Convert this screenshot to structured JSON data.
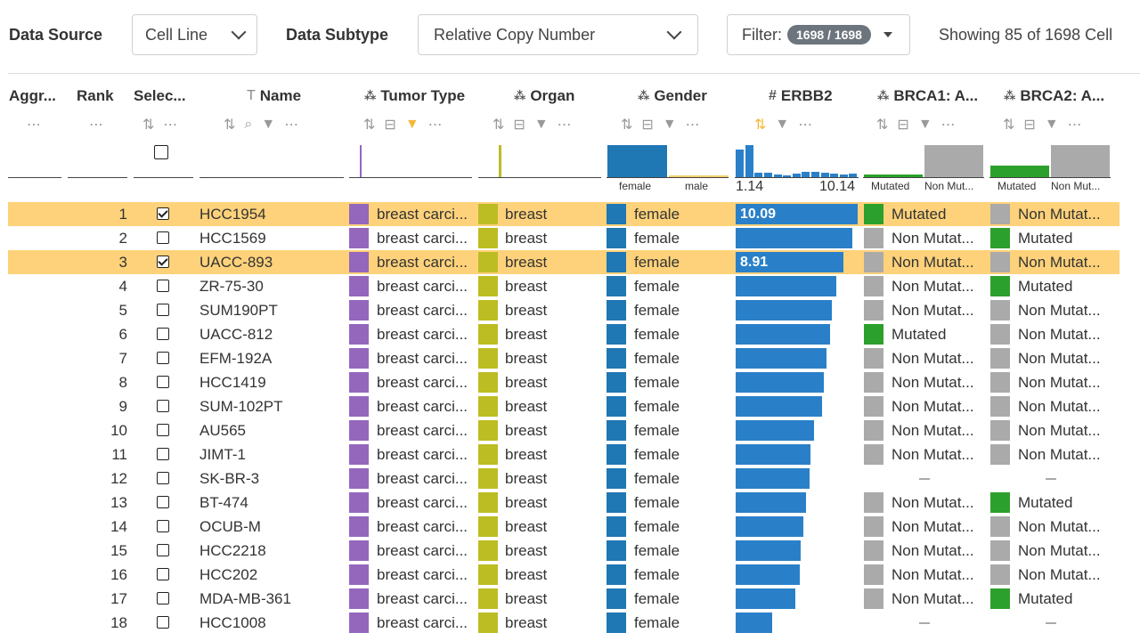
{
  "toolbar": {
    "data_source_label": "Data Source",
    "data_source_value": "Cell Line",
    "data_subtype_label": "Data Subtype",
    "data_subtype_value": "Relative Copy Number",
    "filter_label": "Filter:",
    "filter_count": "1698 / 1698",
    "showing_text": "Showing 85 of 1698 Cell"
  },
  "columns": {
    "aggr": "Aggr...",
    "rank": "Rank",
    "select": "Selec...",
    "name": "Name",
    "tumor_type": "Tumor Type",
    "organ": "Organ",
    "gender": "Gender",
    "erbb2": "ERBB2",
    "brca1": "BRCA1: A...",
    "brca2": "BRCA2: A..."
  },
  "summary": {
    "gender_female": "female",
    "gender_male": "male",
    "erbb2_min": "1.14",
    "erbb2_max": "10.14",
    "brca1_mutated": "Mutated",
    "brca1_non": "Non Mut...",
    "brca2_mutated": "Mutated",
    "brca2_non": "Non Mut...",
    "erbb2_hist": [
      0.85,
      1.0,
      0.15,
      0.15,
      0.08,
      0.05,
      0.1,
      0.18,
      0.18,
      0.14,
      0.12,
      0.08,
      0.12
    ],
    "brca1_mutated_frac": 0.5,
    "brca2_mutated_frac": 0.5
  },
  "colors": {
    "highlight": "#fed27a",
    "tumor": "#9467bd",
    "organ": "#bcbd22",
    "gender": "#1f77b4",
    "bar": "#2a80c8",
    "mutated": "#2ca02c",
    "non_mutated": "#aaaaaa"
  },
  "rows": [
    {
      "rank": "1",
      "selected": true,
      "name": "HCC1954",
      "tumor": "breast carci...",
      "organ": "breast",
      "gender": "female",
      "erbb2": 10.09,
      "erbb2_label": "10.09",
      "brca1": "Mutated",
      "brca2": "Non Mutat..."
    },
    {
      "rank": "2",
      "selected": false,
      "name": "HCC1569",
      "tumor": "breast carci...",
      "organ": "breast",
      "gender": "female",
      "erbb2": 9.6,
      "erbb2_label": "",
      "brca1": "Non Mutat...",
      "brca2": "Mutated"
    },
    {
      "rank": "3",
      "selected": true,
      "name": "UACC-893",
      "tumor": "breast carci...",
      "organ": "breast",
      "gender": "female",
      "erbb2": 8.91,
      "erbb2_label": "8.91",
      "brca1": "Non Mutat...",
      "brca2": "Non Mutat..."
    },
    {
      "rank": "4",
      "selected": false,
      "name": "ZR-75-30",
      "tumor": "breast carci...",
      "organ": "breast",
      "gender": "female",
      "erbb2": 8.3,
      "erbb2_label": "",
      "brca1": "Non Mutat...",
      "brca2": "Mutated"
    },
    {
      "rank": "5",
      "selected": false,
      "name": "SUM190PT",
      "tumor": "breast carci...",
      "organ": "breast",
      "gender": "female",
      "erbb2": 7.9,
      "erbb2_label": "",
      "brca1": "Non Mutat...",
      "brca2": "Non Mutat..."
    },
    {
      "rank": "6",
      "selected": false,
      "name": "UACC-812",
      "tumor": "breast carci...",
      "organ": "breast",
      "gender": "female",
      "erbb2": 7.8,
      "erbb2_label": "",
      "brca1": "Mutated",
      "brca2": "Non Mutat..."
    },
    {
      "rank": "7",
      "selected": false,
      "name": "EFM-192A",
      "tumor": "breast carci...",
      "organ": "breast",
      "gender": "female",
      "erbb2": 7.5,
      "erbb2_label": "",
      "brca1": "Non Mutat...",
      "brca2": "Non Mutat..."
    },
    {
      "rank": "8",
      "selected": false,
      "name": "HCC1419",
      "tumor": "breast carci...",
      "organ": "breast",
      "gender": "female",
      "erbb2": 7.3,
      "erbb2_label": "",
      "brca1": "Non Mutat...",
      "brca2": "Non Mutat..."
    },
    {
      "rank": "9",
      "selected": false,
      "name": "SUM-102PT",
      "tumor": "breast carci...",
      "organ": "breast",
      "gender": "female",
      "erbb2": 7.1,
      "erbb2_label": "",
      "brca1": "Non Mutat...",
      "brca2": "Non Mutat..."
    },
    {
      "rank": "10",
      "selected": false,
      "name": "AU565",
      "tumor": "breast carci...",
      "organ": "breast",
      "gender": "female",
      "erbb2": 6.5,
      "erbb2_label": "",
      "brca1": "Non Mutat...",
      "brca2": "Non Mutat..."
    },
    {
      "rank": "11",
      "selected": false,
      "name": "JIMT-1",
      "tumor": "breast carci...",
      "organ": "breast",
      "gender": "female",
      "erbb2": 6.2,
      "erbb2_label": "",
      "brca1": "Non Mutat...",
      "brca2": "Non Mutat..."
    },
    {
      "rank": "12",
      "selected": false,
      "name": "SK-BR-3",
      "tumor": "breast carci...",
      "organ": "breast",
      "gender": "female",
      "erbb2": 6.1,
      "erbb2_label": "",
      "brca1": "",
      "brca2": ""
    },
    {
      "rank": "13",
      "selected": false,
      "name": "BT-474",
      "tumor": "breast carci...",
      "organ": "breast",
      "gender": "female",
      "erbb2": 5.8,
      "erbb2_label": "",
      "brca1": "Non Mutat...",
      "brca2": "Mutated"
    },
    {
      "rank": "14",
      "selected": false,
      "name": "OCUB-M",
      "tumor": "breast carci...",
      "organ": "breast",
      "gender": "female",
      "erbb2": 5.6,
      "erbb2_label": "",
      "brca1": "Non Mutat...",
      "brca2": "Non Mutat..."
    },
    {
      "rank": "15",
      "selected": false,
      "name": "HCC2218",
      "tumor": "breast carci...",
      "organ": "breast",
      "gender": "female",
      "erbb2": 5.4,
      "erbb2_label": "",
      "brca1": "Non Mutat...",
      "brca2": "Non Mutat..."
    },
    {
      "rank": "16",
      "selected": false,
      "name": "HCC202",
      "tumor": "breast carci...",
      "organ": "breast",
      "gender": "female",
      "erbb2": 5.3,
      "erbb2_label": "",
      "brca1": "Non Mutat...",
      "brca2": "Non Mutat..."
    },
    {
      "rank": "17",
      "selected": false,
      "name": "MDA-MB-361",
      "tumor": "breast carci...",
      "organ": "breast",
      "gender": "female",
      "erbb2": 4.9,
      "erbb2_label": "",
      "brca1": "Non Mutat...",
      "brca2": "Mutated"
    },
    {
      "rank": "18",
      "selected": false,
      "name": "HCC1008",
      "tumor": "breast carci...",
      "organ": "breast",
      "gender": "female",
      "erbb2": 3.0,
      "erbb2_label": "",
      "brca1": "",
      "brca2": ""
    }
  ]
}
